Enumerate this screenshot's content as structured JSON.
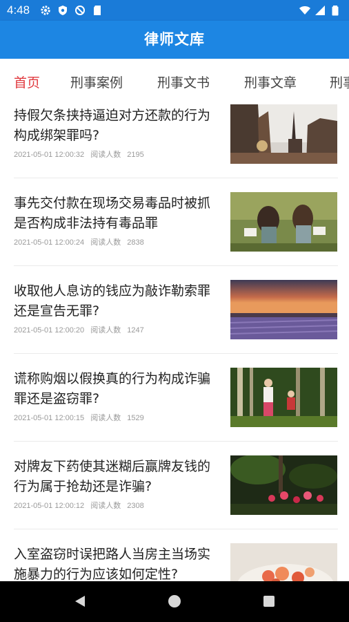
{
  "status_bar": {
    "time": "4:48",
    "left_icons": [
      "gear-icon",
      "shield-icon",
      "blocked-icon",
      "sd-card-icon"
    ],
    "right_icons": [
      "wifi-icon",
      "signal-icon",
      "battery-icon"
    ]
  },
  "app_bar": {
    "title": "律师文库",
    "color": "#1d86e3"
  },
  "tabs": [
    {
      "label": "首页",
      "active": true
    },
    {
      "label": "刑事案例",
      "active": false
    },
    {
      "label": "刑事文书",
      "active": false
    },
    {
      "label": "刑事文章",
      "active": false
    },
    {
      "label": "刑事",
      "active": false
    }
  ],
  "articles": [
    {
      "title": "持假欠条挟持逼迫对方还款的行为构成绑架罪吗?",
      "date": "2021-05-01 12:00:32",
      "reads_label": "阅读人数",
      "reads": "2195",
      "image": "city-gothic-photo"
    },
    {
      "title": "事先交付款在现场交易毒品时被抓是否构成非法持有毒品罪",
      "date": "2021-05-01 12:00:24",
      "reads_label": "阅读人数",
      "reads": "2838",
      "image": "girls-reading-photo"
    },
    {
      "title": "收取他人息访的钱应为敲诈勒索罪还是宣告无罪?",
      "date": "2021-05-01 12:00:20",
      "reads_label": "阅读人数",
      "reads": "1247",
      "image": "lavender-sunset-photo"
    },
    {
      "title": "谎称购烟以假换真的行为构成诈骗罪还是盗窃罪?",
      "date": "2021-05-01 12:00:15",
      "reads_label": "阅读人数",
      "reads": "1529",
      "image": "forest-running-photo"
    },
    {
      "title": "对牌友下药使其迷糊后赢牌友钱的行为属于抢劫还是诈骗?",
      "date": "2021-05-01 12:00:12",
      "reads_label": "阅读人数",
      "reads": "2308",
      "image": "red-flowers-photo"
    },
    {
      "title": "入室盗窃时误把路人当房主当场实施暴力的行为应该如何定性?",
      "date": "",
      "reads_label": "",
      "reads": "",
      "image": "food-dish-photo"
    }
  ],
  "nav_bar": {
    "buttons": [
      "back-icon",
      "home-icon",
      "recents-icon"
    ]
  }
}
